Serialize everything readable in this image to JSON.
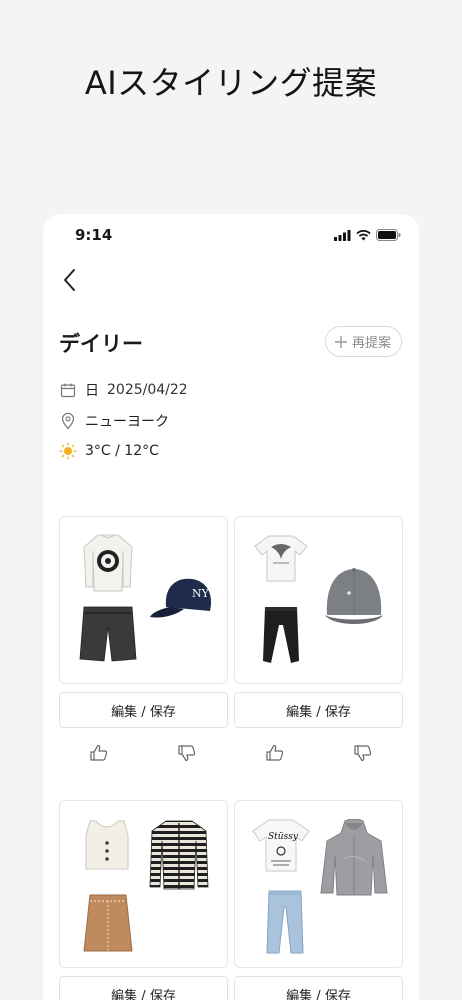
{
  "headline": "AIスタイリング提案",
  "status_bar": {
    "time": "9:14"
  },
  "header": {
    "title": "デイリー",
    "re_suggest_label": "再提案"
  },
  "info": {
    "date_prefix": "日",
    "date": "2025/04/22",
    "location": "ニューヨーク",
    "temperature": "3°C / 12°C"
  },
  "outfits": [
    {
      "edit_label": "編集 / 保存",
      "items": [
        "white-sweater",
        "navy-ny-cap",
        "black-shorts"
      ]
    },
    {
      "edit_label": "編集 / 保存",
      "items": [
        "white-graphic-tee",
        "gray-cap",
        "black-sweatpants"
      ]
    },
    {
      "edit_label": "編集 / 保存",
      "items": [
        "white-knit-vest",
        "striped-cardigan",
        "brown-skirt"
      ]
    },
    {
      "edit_label": "編集 / 保存",
      "items": [
        "stussy-tee",
        "gray-hoodie",
        "light-blue-jeans"
      ]
    }
  ],
  "icons": {
    "back": "chevron-left-icon",
    "plus": "plus-icon",
    "calendar": "calendar-icon",
    "location": "location-pin-icon",
    "weather": "sun-icon",
    "like": "thumbs-up-icon",
    "dislike": "thumbs-down-icon"
  },
  "colors": {
    "background": "#f4f4f4",
    "card_border": "#e6e6e6",
    "sun": "#f2b21b"
  }
}
